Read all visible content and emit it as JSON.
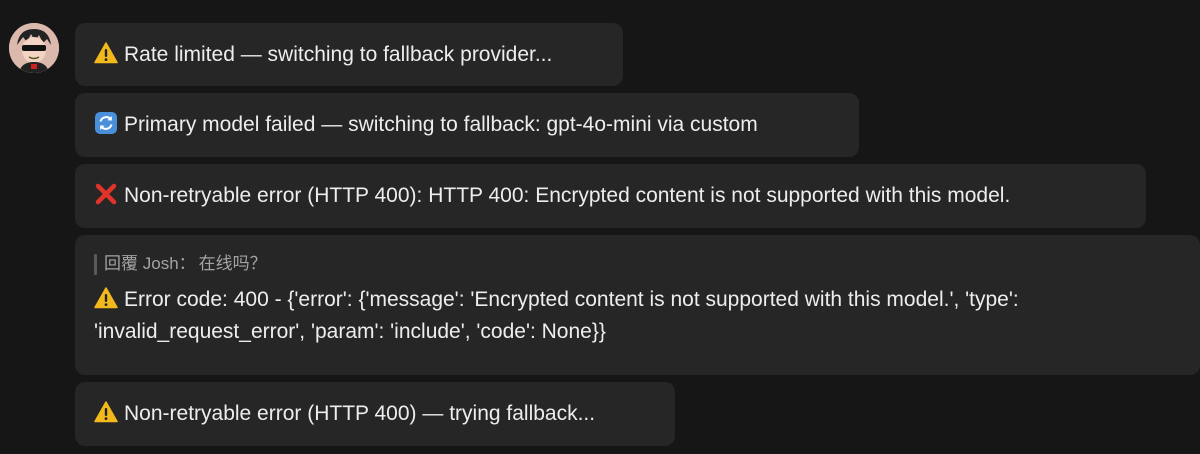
{
  "avatar": {
    "alt": "user avatar"
  },
  "messages": [
    {
      "icon": "warning-icon",
      "text": "Rate limited — switching to fallback provider..."
    },
    {
      "icon": "refresh-icon",
      "text": "Primary model failed — switching to fallback: gpt-4o-mini via custom"
    },
    {
      "icon": "cross-icon",
      "text": "Non-retryable error (HTTP 400): HTTP 400: Encrypted content is not supported with this model."
    },
    {
      "reply": {
        "prefix": "回覆",
        "author": "Josh",
        "separator": "：",
        "quote": "在线吗？"
      },
      "icon": "warning-icon",
      "text": "Error code: 400 - {'error': {'message': 'Encrypted content is not supported with this model.', 'type': 'invalid_request_error', 'param': 'include', 'code': None}}"
    },
    {
      "icon": "warning-icon",
      "text": "Non-retryable error (HTTP 400) — trying fallback..."
    }
  ],
  "colors": {
    "background": "#161616",
    "bubble": "#262626",
    "text": "#ededed",
    "muted": "#a3a3a3",
    "warning": "#f2b91c",
    "error": "#e0342a",
    "refresh": "#4a8fd9"
  }
}
